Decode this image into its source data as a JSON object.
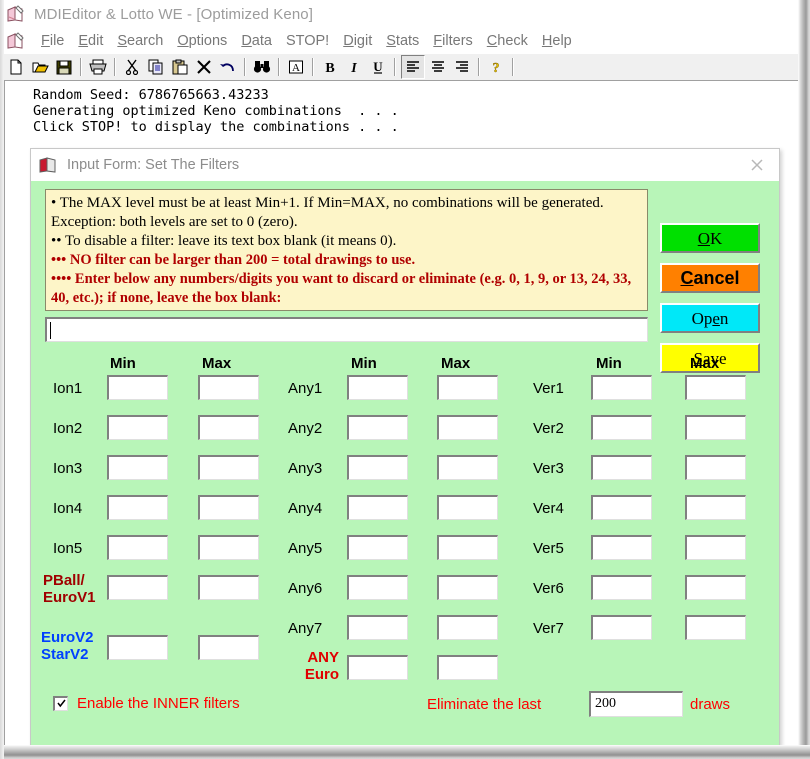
{
  "window": {
    "title": "MDIEditor & Lotto WE - [Optimized Keno]",
    "icon": "app-book-pen-icon"
  },
  "menu": {
    "items": [
      {
        "label": "File",
        "accel": "F"
      },
      {
        "label": "Edit",
        "accel": "E"
      },
      {
        "label": "Search",
        "accel": "S"
      },
      {
        "label": "Options",
        "accel": "O"
      },
      {
        "label": "Data",
        "accel": "D"
      },
      {
        "label": "STOP!",
        "accel": ""
      },
      {
        "label": "Digit",
        "accel": "D"
      },
      {
        "label": "Stats",
        "accel": "S"
      },
      {
        "label": "Filters",
        "accel": "F"
      },
      {
        "label": "Check",
        "accel": "C"
      },
      {
        "label": "Help",
        "accel": "H"
      }
    ]
  },
  "toolbar": {
    "buttons": [
      "new-document-icon",
      "open-folder-icon",
      "save-disk-icon",
      "print-icon",
      "cut-scissors-icon",
      "copy-icon",
      "paste-icon",
      "delete-x-icon",
      "undo-arrow-icon",
      "find-binoculars-icon",
      "font-icon",
      "bold-icon",
      "italic-icon",
      "underline-icon",
      "align-left-icon",
      "align-center-icon",
      "align-right-icon",
      "help-question-icon"
    ]
  },
  "console": {
    "lines": [
      "Random Seed: 6786765663.43233",
      "Generating optimized Keno combinations  . . .",
      "Click STOP! to display the combinations . . ."
    ]
  },
  "dialog": {
    "title": "Input Form: Set The Filters",
    "close_icon": "close-x-icon",
    "icon": "dialog-book-icon",
    "info": {
      "line1": "• The MAX level must be at least Min+1. If Min=MAX, no combinations will be generated.  Exception: both levels are set to 0 (zero).",
      "line2": "•• To disable a filter: leave its text box blank (it means 0).",
      "line3": "••• NO filter can be larger than 200 = total drawings to use.",
      "line4": "•••• Enter below any numbers/digits you want to discard or eliminate  (e.g.  0, 1, 9, or 13, 24, 33, 40, etc.);  if none, leave the box blank:"
    },
    "discard_input": {
      "value": "",
      "placeholder": ""
    },
    "buttons": {
      "ok": {
        "pre": "",
        "accel": "O",
        "post": "K"
      },
      "cancel": {
        "pre": "",
        "accel": "C",
        "post": "ancel"
      },
      "open": {
        "pre": "Op",
        "accel": "e",
        "post": "n"
      },
      "save": {
        "pre": "",
        "accel": "S",
        "post": "ave"
      }
    },
    "columns": [
      {
        "name": "ion",
        "min_header": "Min",
        "max_header": "Max"
      },
      {
        "name": "any",
        "min_header": "Min",
        "max_header": "Max"
      },
      {
        "name": "ver",
        "min_header": "Min",
        "max_header": "Max"
      }
    ],
    "ion_rows": [
      {
        "label": "Ion1",
        "min": "",
        "max": ""
      },
      {
        "label": "Ion2",
        "min": "",
        "max": ""
      },
      {
        "label": "Ion3",
        "min": "",
        "max": ""
      },
      {
        "label": "Ion4",
        "min": "",
        "max": ""
      },
      {
        "label": "Ion5",
        "min": "",
        "max": ""
      },
      {
        "label": "PBall/\nEuroV1",
        "min": "",
        "max": ""
      },
      {
        "label": "EuroV2\nStarV2",
        "min": "",
        "max": ""
      }
    ],
    "any_rows": [
      {
        "label": "Any1",
        "min": "",
        "max": ""
      },
      {
        "label": "Any2",
        "min": "",
        "max": ""
      },
      {
        "label": "Any3",
        "min": "",
        "max": ""
      },
      {
        "label": "Any4",
        "min": "",
        "max": ""
      },
      {
        "label": "Any5",
        "min": "",
        "max": ""
      },
      {
        "label": "Any6",
        "min": "",
        "max": ""
      },
      {
        "label": "Any7",
        "min": "",
        "max": ""
      },
      {
        "label": "ANY\nEuro",
        "min": "",
        "max": ""
      }
    ],
    "ver_rows": [
      {
        "label": "Ver1",
        "min": "",
        "max": ""
      },
      {
        "label": "Ver2",
        "min": "",
        "max": ""
      },
      {
        "label": "Ver3",
        "min": "",
        "max": ""
      },
      {
        "label": "Ver4",
        "min": "",
        "max": ""
      },
      {
        "label": "Ver5",
        "min": "",
        "max": ""
      },
      {
        "label": "Ver6",
        "min": "",
        "max": ""
      },
      {
        "label": "Ver7",
        "min": "",
        "max": ""
      }
    ],
    "footer": {
      "inner_filters_label": "Enable the INNER filters",
      "inner_filters_checked": true,
      "eliminate_label": "Eliminate the last",
      "eliminate_value": "200",
      "draws_label": "draws"
    }
  },
  "colors": {
    "dialog_bg": "#b8f5b8",
    "info_bg": "#fdf5c8",
    "ok": "#00e000",
    "cancel": "#ff8000",
    "open": "#00e8f8",
    "save": "#ffff00",
    "red_text": "#ff0000",
    "dark_red_text": "#a00000",
    "blue_text": "#0040ff"
  }
}
